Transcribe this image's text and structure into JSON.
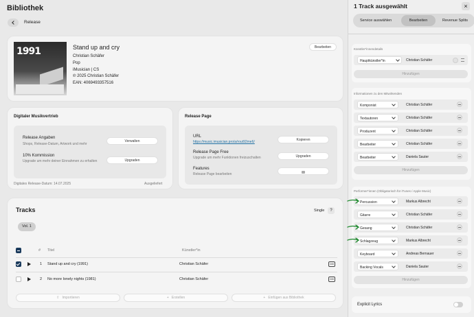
{
  "header": {
    "title": "Bibliothek",
    "back_label": "Release"
  },
  "release": {
    "title": "Stand up and cry",
    "artist": "Christian Schäfer",
    "genre": "Pop",
    "label": "iMusician | CS",
    "copyright": "℗ 2025 Christian Schäfer",
    "ean": "EAN: 4069493357516",
    "edit_label": "Bearbeiten",
    "cover_number": "1991"
  },
  "distribution": {
    "title": "Digitaler Musikvertrieb",
    "release_heading": "Release Angaben",
    "release_sub": "Shops, Release-Datum, Artwork und mehr",
    "manage_label": "Verwalten",
    "commission_heading": "10% Kommission",
    "commission_sub": "Upgrade um mehr deiner Einnahmen zu erhalten",
    "upgrade_label": "Upgraden",
    "date_text": "Digitales Release-Datum: 14.07.2025",
    "status_text": "Ausgeliefert"
  },
  "release_page": {
    "title": "Release Page",
    "url_heading": "URL",
    "url_value": "https://music.imusician.pro/a/rout92me6/",
    "copy_label": "Kopieren",
    "free_heading": "Release Page Free",
    "free_sub": "Upgrade um mehr Funktionen freizuschalten",
    "upgrade_label": "Upgraden",
    "features_heading": "Features",
    "features_sub": "Release Page bearbeiten"
  },
  "tracks": {
    "title": "Tracks",
    "mode": "Single",
    "help": "?",
    "volume": "Vol. 1",
    "col_num": "#",
    "col_title": "Titel",
    "col_artist": "Künstler*in",
    "rows": [
      {
        "num": "1",
        "title": "Stand up and cry (1991)",
        "artist": "Christian Schäfer",
        "checked": true,
        "badge": "CID"
      },
      {
        "num": "2",
        "title": "No more lonely nights (1981)",
        "artist": "Christian Schäfer",
        "checked": false,
        "badge": "CID"
      }
    ],
    "import_label": "Importieren",
    "create_label": "Erstellen",
    "insert_label": "Einfügen aus Bibliothek"
  },
  "panel": {
    "title": "1 Track ausgewählt",
    "tabs": [
      "Service auswählen",
      "Bearbeiten",
      "Revenue Splits"
    ],
    "active_tab": 1,
    "artist_section": {
      "heading": "Künstler*innendetails",
      "rows": [
        {
          "role": "Hauptkünstler*in",
          "name": "Christian Schäfer"
        }
      ],
      "add_label": "Hinzufügen"
    },
    "contributors_section": {
      "heading": "Informationen zu den Mitwirkenden",
      "rows": [
        {
          "role": "Komponist",
          "name": "Christian Schäfer"
        },
        {
          "role": "Textautoren",
          "name": "Christian Schäfer"
        },
        {
          "role": "Produzent",
          "name": "Christian Schäfer"
        },
        {
          "role": "Bearbeiter",
          "name": "Christian Schäfer"
        },
        {
          "role": "Bearbeiter",
          "name": "Daniela Sauter"
        }
      ],
      "add_label": "Hinzufügen"
    },
    "performers_section": {
      "heading": "Performer*innen (Obligatorisch für iTunes / Apple Music)",
      "rows": [
        {
          "role": "Percussion",
          "name": "Markus Albrecht",
          "marked": true
        },
        {
          "role": "Gitarre",
          "name": "Christian Schäfer",
          "marked": false
        },
        {
          "role": "Gesang",
          "name": "Christian Schäfer",
          "marked": true
        },
        {
          "role": "Schlagzeug",
          "name": "Markus Albrecht",
          "marked": true
        },
        {
          "role": "Keyboard",
          "name": "Andreas Bernauer",
          "marked": false
        },
        {
          "role": "Backing Vocals",
          "name": "Daniela Sauter",
          "marked": false
        }
      ],
      "add_label": "Hinzufügen"
    },
    "explicit_label": "Explicit Lyrics",
    "close": "×"
  }
}
